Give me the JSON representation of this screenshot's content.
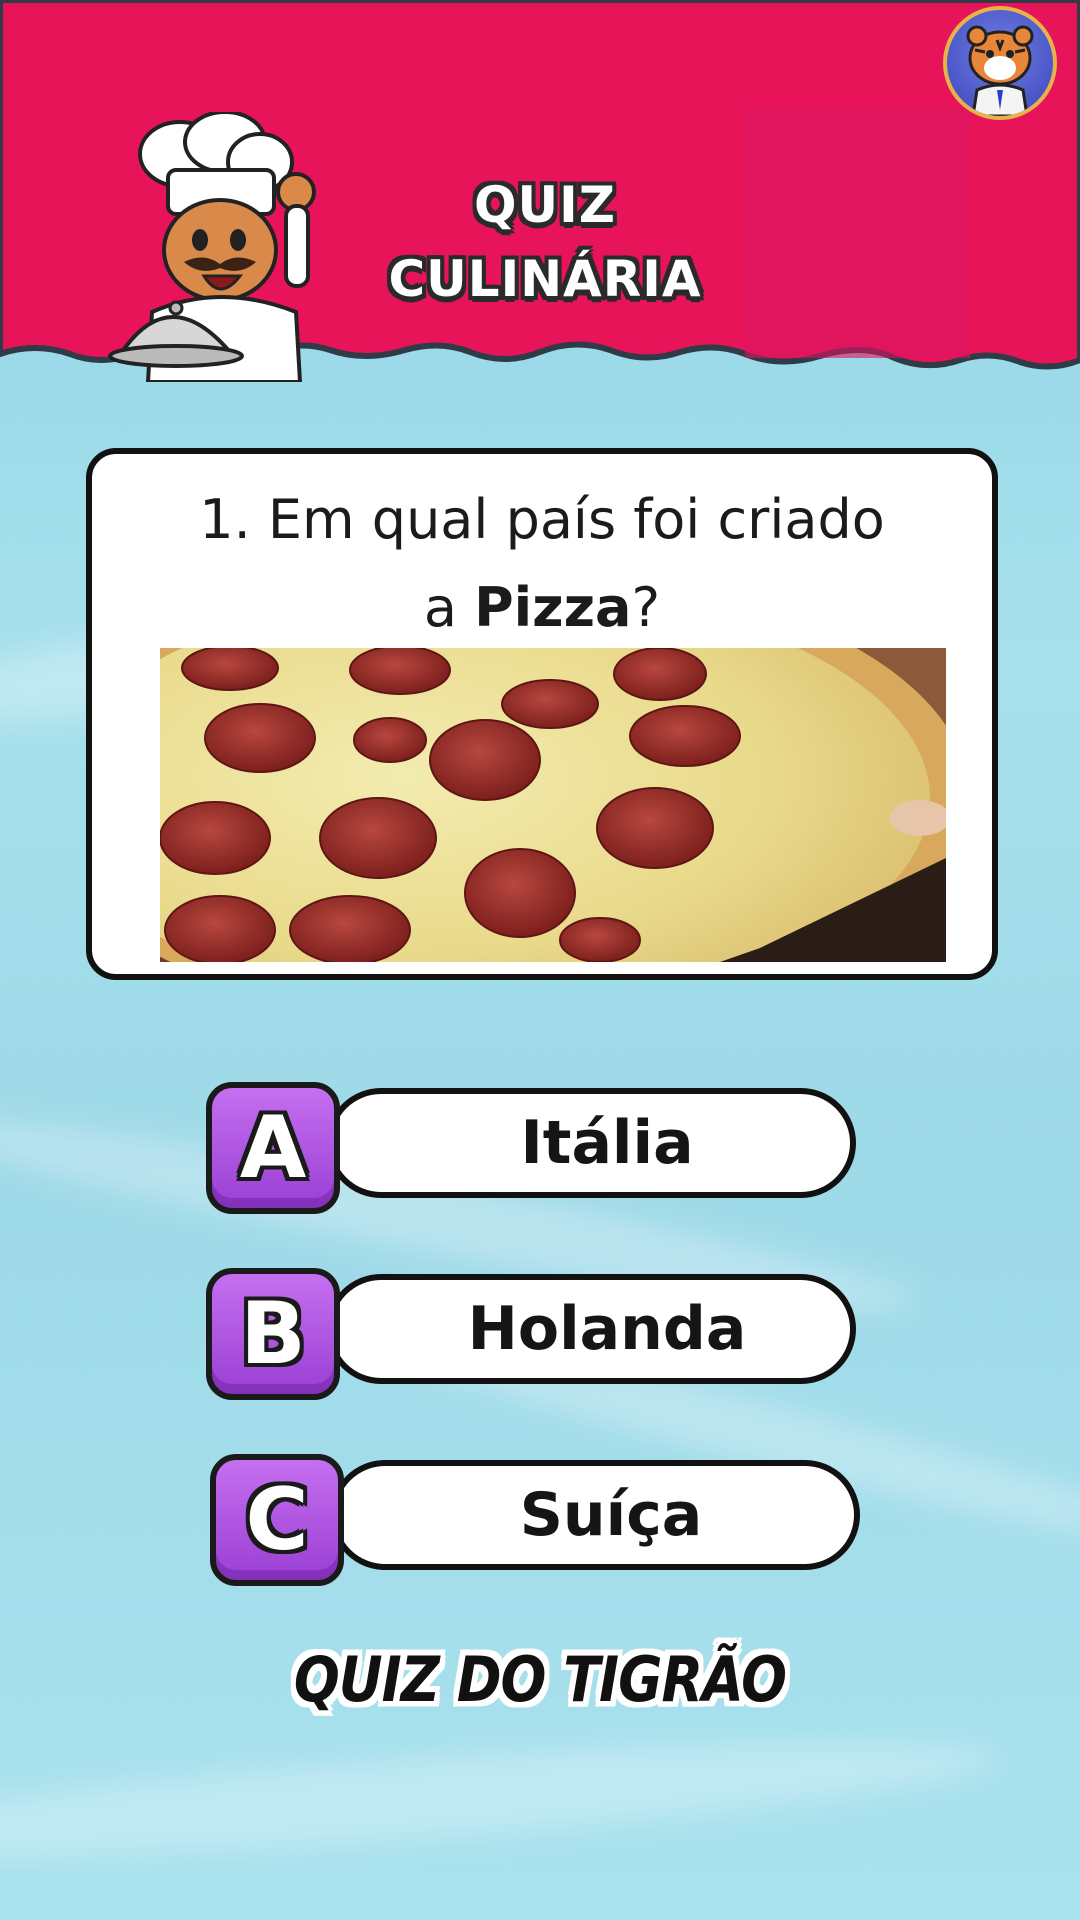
{
  "header": {
    "title_line1": "QUIZ",
    "title_line2": "CULINÁRIA",
    "background_color": "#e8145a"
  },
  "question": {
    "prefix": "1. Em qual país foi criado",
    "line2_start": "a ",
    "highlight": "Pizza",
    "line2_end": "?",
    "image_icon": "pepperoni-pizza-photo"
  },
  "options": [
    {
      "letter": "A",
      "label": "Itália"
    },
    {
      "letter": "B",
      "label": "Holanda"
    },
    {
      "letter": "C",
      "label": "Suíça"
    }
  ],
  "footer": {
    "brand": "QUIZ DO TIGRÃO"
  },
  "colors": {
    "header": "#e8145a",
    "badge": "#a64bdc",
    "background": "#9fdbe9"
  }
}
